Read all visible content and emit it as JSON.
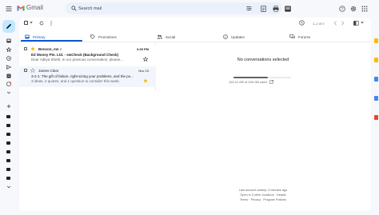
{
  "app": {
    "title": "Gmail",
    "colors": {
      "brand_red": "#ea4335",
      "accent_blue": "#0b57d0",
      "compose_bg": "#c2e7ff",
      "star_yellow": "#f4b400"
    }
  },
  "search": {
    "placeholder": "Search mail"
  },
  "toolbar": {
    "pagination": "1–2 of 2"
  },
  "tabs": [
    {
      "label": "Primary",
      "icon": "inbox-icon",
      "active": true
    },
    {
      "label": "Promotions",
      "icon": "tag-icon",
      "active": false
    },
    {
      "label": "Social",
      "icon": "people-icon",
      "active": false
    },
    {
      "label": "Updates",
      "icon": "info-icon",
      "active": false
    },
    {
      "label": "Forums",
      "icon": "forum-icon",
      "active": false
    }
  ],
  "emails": [
    {
      "sender": "Benson, me",
      "count": "2",
      "date": "3:35 PM",
      "subject": "EZ Money Pte. Ltd. - swCheck (Background Check)",
      "snippet": "Dear Aditya Sheth, In our previous conversation, please...",
      "unread": true,
      "starred": true
    },
    {
      "sender": "James Clear",
      "count": "",
      "date": "Nov 23",
      "subject": "3-2-1: The gift of failure, right-sizing your problems, and the po...",
      "snippet": "3 ideas, 2 quotes, and 1 question to consider this week.",
      "unread": false,
      "starred": false
    }
  ],
  "preview": {
    "empty_message": "No conversations selected",
    "storage_text": "120.11 GB of 200 GB used",
    "storage_used_fraction": 0.6
  },
  "footer": {
    "activity": "Last account activity: 0 minutes ago",
    "locations": "Open in 3 other locations · Details",
    "links": "Terms · Privacy · Program Policies"
  }
}
